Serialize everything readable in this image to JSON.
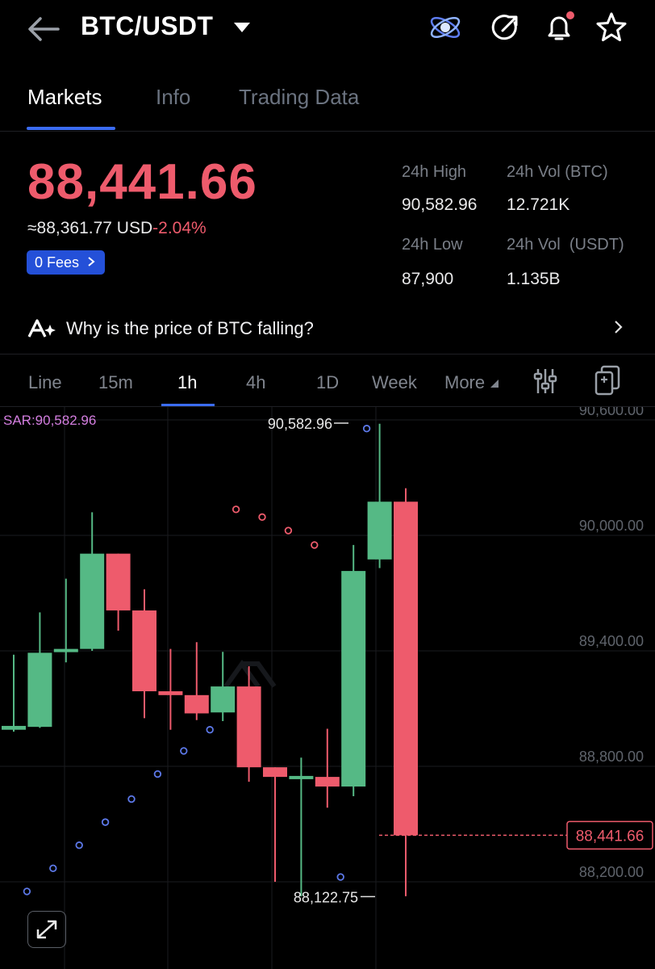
{
  "header": {
    "pair": "BTC/USDT",
    "icons": [
      "back-arrow-icon",
      "dropdown-caret-icon",
      "ai-orb-icon",
      "share-icon",
      "bell-icon",
      "star-icon"
    ]
  },
  "tabs": [
    {
      "label": "Markets",
      "active": true
    },
    {
      "label": "Info",
      "active": false
    },
    {
      "label": "Trading Data",
      "active": false
    }
  ],
  "ticker": {
    "last_price": "88,441.66",
    "usd_equiv": "≈88,361.77",
    "usd_unit": "USD",
    "change": "-2.04%",
    "fees_label": "0 Fees",
    "high_label": "24h High",
    "high_value": "90,582.96",
    "low_label": "24h Low",
    "low_value": "87,900",
    "vol_btc_label": "24h Vol (BTC)",
    "vol_btc_value": "12.721K",
    "vol_usdt_label": "24h Vol  (USDT)",
    "vol_usdt_value": "1.135B"
  },
  "ai_prompt": "Why is the price of BTC falling?",
  "timeframes": [
    {
      "label": "Line",
      "active": false
    },
    {
      "label": "15m",
      "active": false
    },
    {
      "label": "1h",
      "active": true
    },
    {
      "label": "4h",
      "active": false
    },
    {
      "label": "1D",
      "active": false
    },
    {
      "label": "Week",
      "active": false
    },
    {
      "label": "More",
      "active": false
    }
  ],
  "colors": {
    "up": "#55b985",
    "down": "#ee5b6c",
    "sar_above": "#ee5b6c",
    "sar_below": "#5c78e8",
    "accent": "#3b6cf5"
  },
  "chart_data": {
    "type": "candlestick",
    "indicator_label": "SAR:90,582.96",
    "y_ticks": [
      90600,
      90000,
      89400,
      88800,
      88200
    ],
    "y_tick_labels": [
      "90,600.00",
      "90,000.00",
      "89,400.00",
      "88,800.00",
      "88,200.00"
    ],
    "current_price_label": "88,441.66",
    "current_price": 88441.66,
    "high_marker": {
      "label": "90,582.96",
      "value": 90582.96
    },
    "low_marker": {
      "label": "88,122.75",
      "value": 88122.75
    },
    "candles": [
      {
        "o": 88990,
        "h": 89380,
        "l": 88980,
        "c": 89010
      },
      {
        "o": 89005,
        "h": 89600,
        "l": 89000,
        "c": 89390
      },
      {
        "o": 89395,
        "h": 89775,
        "l": 89340,
        "c": 89410
      },
      {
        "o": 89410,
        "h": 90120,
        "l": 89400,
        "c": 89905
      },
      {
        "o": 89905,
        "h": 89905,
        "l": 89505,
        "c": 89610
      },
      {
        "o": 89610,
        "h": 89720,
        "l": 89050,
        "c": 89190
      },
      {
        "o": 89190,
        "h": 89410,
        "l": 88990,
        "c": 89170
      },
      {
        "o": 89170,
        "h": 89445,
        "l": 89040,
        "c": 89075
      },
      {
        "o": 89080,
        "h": 89395,
        "l": 89035,
        "c": 89215
      },
      {
        "o": 89215,
        "h": 89320,
        "l": 88720,
        "c": 88795
      },
      {
        "o": 88795,
        "h": 88795,
        "l": 88200,
        "c": 88745
      },
      {
        "o": 88745,
        "h": 88845,
        "l": 88125,
        "c": 88750
      },
      {
        "o": 88745,
        "h": 88995,
        "l": 88585,
        "c": 88695
      },
      {
        "o": 88695,
        "h": 89950,
        "l": 88645,
        "c": 89815
      },
      {
        "o": 89875,
        "h": 90580,
        "l": 89830,
        "c": 90175
      },
      {
        "o": 90175,
        "h": 90245,
        "l": 88125,
        "c": 88441.66
      }
    ],
    "sar_points": [
      {
        "i": 1,
        "v": 88150
      },
      {
        "i": 2,
        "v": 88270
      },
      {
        "i": 3,
        "v": 88390
      },
      {
        "i": 4,
        "v": 88510
      },
      {
        "i": 5,
        "v": 88630
      },
      {
        "i": 6,
        "v": 88760
      },
      {
        "i": 7,
        "v": 88880
      },
      {
        "i": 8,
        "v": 88990
      },
      {
        "i": 9,
        "v": 90135
      },
      {
        "i": 10,
        "v": 90095
      },
      {
        "i": 11,
        "v": 90025
      },
      {
        "i": 12,
        "v": 89950
      },
      {
        "i": 13,
        "v": 88225
      },
      {
        "i": 14,
        "v": 90555
      }
    ]
  }
}
